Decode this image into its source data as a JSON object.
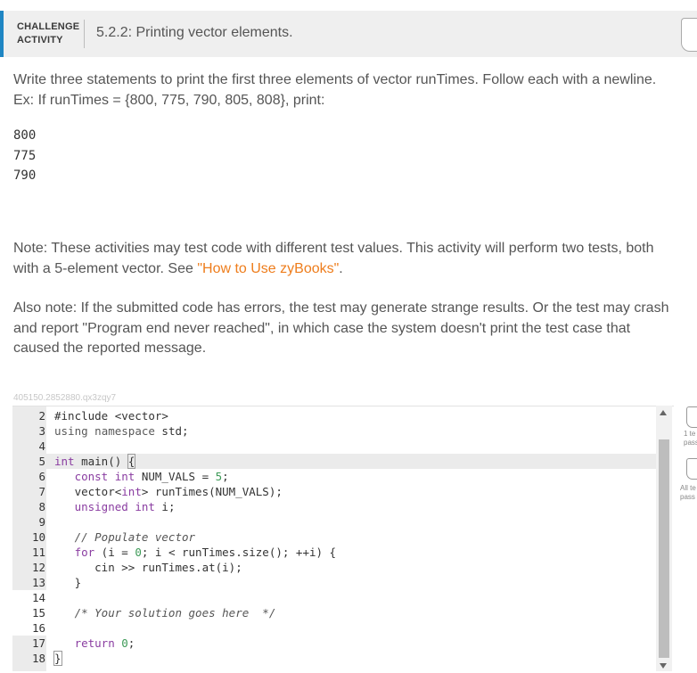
{
  "header": {
    "activity_type_line1": "CHALLENGE",
    "activity_type_line2": "ACTIVITY",
    "title": "5.2.2: Printing vector elements."
  },
  "instructions": {
    "prompt": "Write three statements to print the first three elements of vector runTimes. Follow each with a newline. Ex: If runTimes = {800, 775, 790, 805, 808}, print:",
    "example_output": [
      "800",
      "775",
      "790"
    ],
    "note_text": "Note: These activities may test code with different test values. This activity will perform two tests, both with a 5-element vector. See ",
    "note_link": "\"How to Use zyBooks\"",
    "note_end": ".",
    "also_note": "Also note: If the submitted code has errors, the test may generate strange results. Or the test may crash and report \"Program end never reached\", in which case the system doesn't print the test case that caused the reported message."
  },
  "challenge_id": "405150.2852880.qx3zqy7",
  "editor": {
    "line_numbers": [
      "2",
      "3",
      "4",
      "5",
      "6",
      "7",
      "8",
      "9",
      "10",
      "11",
      "12",
      "13",
      "14",
      "15",
      "16",
      "17",
      "18"
    ],
    "lines": [
      "#include <vector>",
      "using namespace std;",
      "",
      "int main() {",
      "   const int NUM_VALS = 5;",
      "   vector<int> runTimes(NUM_VALS);",
      "   unsigned int i;",
      "",
      "   // Populate vector",
      "   for (i = 0; i < runTimes.size(); ++i) {",
      "      cin >> runTimes.at(i);",
      "   }",
      "",
      "   /* Your solution goes here  */",
      "",
      "   return 0;",
      "}"
    ]
  },
  "side_panel": {
    "test1_line1": "1 te",
    "test1_line2": "pass",
    "test2_line1": "All te",
    "test2_line2": "pass"
  },
  "colors": {
    "accent": "#1f86c3",
    "link": "#ee7d1c",
    "header_bg": "#efefef"
  }
}
